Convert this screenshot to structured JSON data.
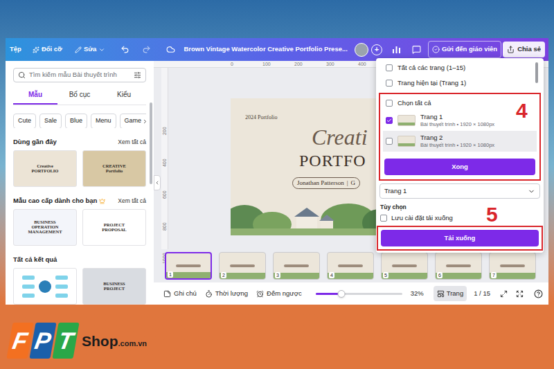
{
  "topbar": {
    "file": "Tệp",
    "resize": "Đổi cỡ",
    "edit": "Sửa",
    "title": "Brown Vintage Watercolor Creative Portfolio Prese...",
    "add": "+",
    "send": "Gửi đến giáo viên",
    "share": "Chia sẻ"
  },
  "sidebar": {
    "search_placeholder": "Tìm kiếm mẫu Bài thuyết trình",
    "tabs": [
      {
        "label": "Mẫu",
        "selected": true
      },
      {
        "label": "Bố cục",
        "selected": false
      },
      {
        "label": "Kiểu",
        "selected": false
      }
    ],
    "chips": [
      "Cute",
      "Sale",
      "Blue",
      "Menu",
      "Game"
    ],
    "sections": [
      {
        "title": "Dùng gần đây",
        "link": "Xem tất cả",
        "crown": false,
        "thumbs": [
          {
            "kind": "text",
            "lines": [
              "Creative",
              "PORTFOLIO"
            ],
            "color": "#ece4d6"
          },
          {
            "kind": "text",
            "lines": [
              "CREATIVE",
              "Portfolio"
            ],
            "color": "#d8c8a4"
          }
        ]
      },
      {
        "title": "Mẫu cao cấp dành cho bạn",
        "link": "Xem tất cả",
        "crown": true,
        "thumbs": [
          {
            "kind": "text",
            "lines": [
              "BUSINESS",
              "OPERATION",
              "MANAGEMENT"
            ],
            "color": "#f3f5fa"
          },
          {
            "kind": "text",
            "lines": [
              "PROJECT",
              "PROPOSAL"
            ],
            "color": "#ffffff"
          }
        ]
      },
      {
        "title": "Tất cả kết quả",
        "link": "",
        "crown": false,
        "thumbs": [
          {
            "kind": "diagram",
            "lines": [],
            "color": "#ffffff"
          },
          {
            "kind": "text",
            "lines": [
              "BUSINESS",
              "PROJECT"
            ],
            "color": "#d9dce1"
          }
        ]
      }
    ]
  },
  "rulers": {
    "top": [
      "0",
      "100",
      "200",
      "300",
      "400"
    ],
    "left": [
      "200",
      "400",
      "600",
      "800",
      "1000"
    ]
  },
  "slide": {
    "year": "2024 Portfolio",
    "script": "Creati",
    "heading": "PORTFO",
    "author": "Jonathan Patterson",
    "divider": "|",
    "author_rest": "G"
  },
  "filmstrip": [
    {
      "number": "1",
      "selected": true
    },
    {
      "number": "2",
      "selected": false
    },
    {
      "number": "3",
      "selected": false
    },
    {
      "number": "4",
      "selected": false
    },
    {
      "number": "5",
      "selected": false
    },
    {
      "number": "6",
      "selected": false
    },
    {
      "number": "7",
      "selected": false
    }
  ],
  "bottom_bar": {
    "notes": "Ghi chú",
    "duration": "Thời lượng",
    "timer": "Đếm ngược",
    "zoom": {
      "level": 0.3,
      "reading": "32%"
    },
    "pages_button": {
      "label": "Trang",
      "selected": true
    },
    "page_count": "1 / 15"
  },
  "download_panel": {
    "options": [
      {
        "label": "Tất cả các trang (1–15)",
        "checked": false
      },
      {
        "label": "Trang hiện tại (Trang 1)",
        "checked": false
      }
    ],
    "select_all": {
      "label": "Chọn tất cả",
      "checked": false
    },
    "pages": [
      {
        "label": "Trang 1",
        "sub": "Bài thuyết trình • 1920 × 1080px",
        "checked": true,
        "hovered": false
      },
      {
        "label": "Trang 2",
        "sub": "Bài thuyết trình • 1920 × 1080px",
        "checked": false,
        "hovered": true
      }
    ],
    "done": "Xong",
    "select_value": "Trang 1",
    "options_title": "Tùy chọn",
    "save_setting": {
      "label": "Lưu cài đặt tải xuống",
      "checked": false
    },
    "download": "Tải xuống"
  },
  "annotations": [
    {
      "label": "4"
    },
    {
      "label": "5"
    }
  ],
  "watermark": {
    "letters": [
      {
        "char": "F",
        "color": "#f37021"
      },
      {
        "char": "P",
        "color": "#1b5faa"
      },
      {
        "char": "T",
        "color": "#2aa748"
      }
    ],
    "site": "Shop",
    "domain": ".com.vn"
  }
}
